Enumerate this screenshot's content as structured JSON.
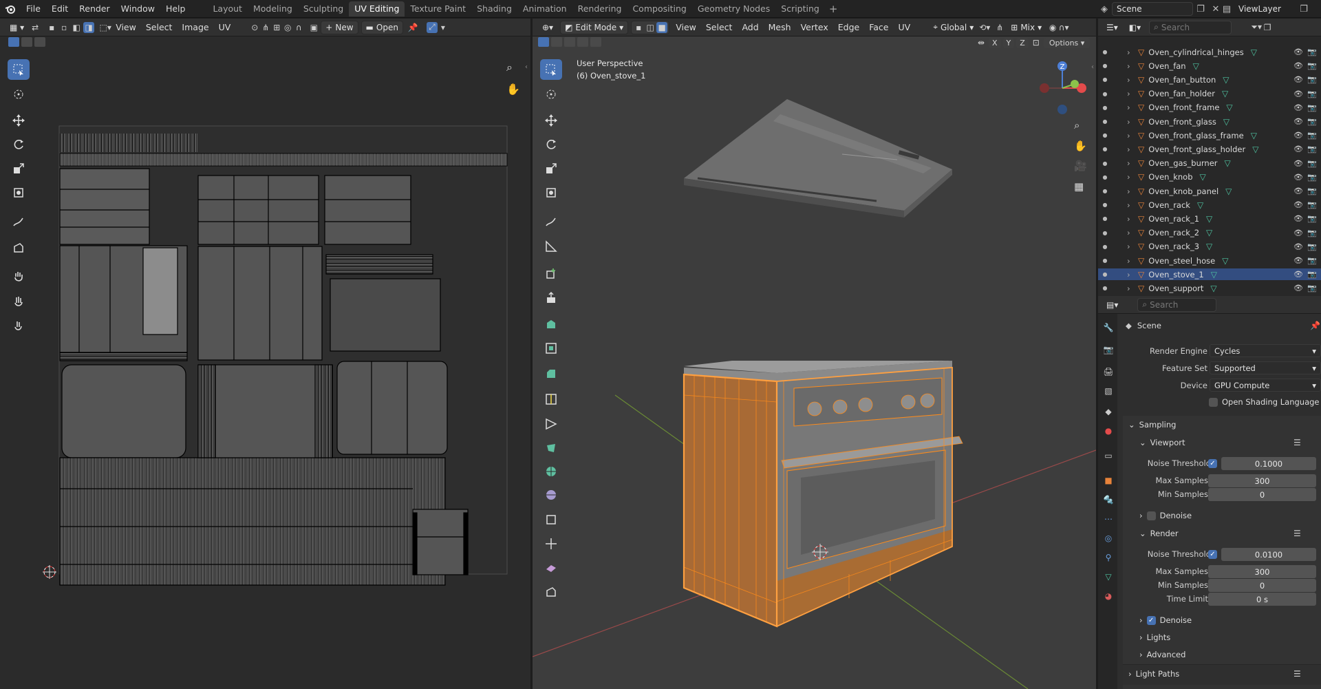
{
  "topbar": {
    "menus": [
      "File",
      "Edit",
      "Render",
      "Window",
      "Help"
    ],
    "workspaces": [
      "Layout",
      "Modeling",
      "Sculpting",
      "UV Editing",
      "Texture Paint",
      "Shading",
      "Animation",
      "Rendering",
      "Compositing",
      "Geometry Nodes",
      "Scripting"
    ],
    "active_workspace": "UV Editing",
    "scene_label": "Scene",
    "viewlayer_label": "ViewLayer"
  },
  "uv_editor": {
    "menus": [
      "View",
      "Select",
      "Image",
      "UV"
    ],
    "new_label": "New",
    "open_label": "Open"
  },
  "viewport": {
    "mode_label": "Edit Mode",
    "menus": [
      "View",
      "Select",
      "Add",
      "Mesh",
      "Vertex",
      "Edge",
      "Face",
      "UV"
    ],
    "transform_orientation": "Global",
    "shading_mix": "Mix",
    "options_label": "Options",
    "axis_x": "X",
    "axis_y": "Y",
    "axis_z": "Z",
    "overlay_title": "User Perspective",
    "overlay_object": "(6) Oven_stove_1",
    "gizmo_z": "Z"
  },
  "outliner": {
    "search_placeholder": "Search",
    "items": [
      "Oven_cylindrical_hinges",
      "Oven_fan",
      "Oven_fan_button",
      "Oven_fan_holder",
      "Oven_front_frame",
      "Oven_front_glass",
      "Oven_front_glass_frame",
      "Oven_front_glass_holder",
      "Oven_gas_burner",
      "Oven_knob",
      "Oven_knob_panel",
      "Oven_rack",
      "Oven_rack_1",
      "Oven_rack_2",
      "Oven_rack_3",
      "Oven_steel_hose",
      "Oven_stove_1",
      "Oven_support"
    ],
    "selected": "Oven_stove_1"
  },
  "properties": {
    "search_placeholder": "Search",
    "context": "Scene",
    "render_engine_label": "Render Engine",
    "render_engine": "Cycles",
    "feature_set_label": "Feature Set",
    "feature_set": "Supported",
    "device_label": "Device",
    "device": "GPU Compute",
    "osl_label": "Open Shading Language",
    "sampling_label": "Sampling",
    "viewport_label": "Viewport",
    "render_label": "Render",
    "noise_threshold_label": "Noise Threshold",
    "max_samples_label": "Max Samples",
    "min_samples_label": "Min Samples",
    "time_limit_label": "Time Limit",
    "denoise_label": "Denoise",
    "viewport_noise_threshold": "0.1000",
    "viewport_max_samples": "300",
    "viewport_min_samples": "0",
    "render_noise_threshold": "0.0100",
    "render_max_samples": "300",
    "render_min_samples": "0",
    "render_time_limit": "0 s",
    "lights_label": "Lights",
    "advanced_label": "Advanced",
    "light_paths_label": "Light Paths"
  },
  "colors": {
    "accent": "#4772b3",
    "selection_orange": "#ff8c1a",
    "mesh_icon": "#4fc3a1",
    "object_icon": "#e8833a"
  }
}
